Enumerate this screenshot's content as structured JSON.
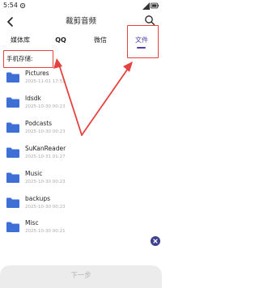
{
  "status_bar": {
    "time": "5:54",
    "icons": [
      "settings-icon",
      "signal-icon",
      "battery-icon"
    ]
  },
  "header": {
    "title": "裁剪音频",
    "back_icon": "back-arrow-icon",
    "search_icon": "search-icon"
  },
  "tabs": [
    {
      "label": "媒体库",
      "active": false
    },
    {
      "label": "QQ",
      "active": false
    },
    {
      "label": "微信",
      "active": false
    },
    {
      "label": "文件",
      "active": true
    }
  ],
  "storage_label": "手机存储:",
  "files": [
    {
      "name": "Pictures",
      "date": "2025-11-01 17:53"
    },
    {
      "name": "ldsdk",
      "date": "2025-10-30 00:23"
    },
    {
      "name": "Podcasts",
      "date": "2025-10-30 00:23"
    },
    {
      "name": "SuKanReader",
      "date": "2025-10-31 01:27"
    },
    {
      "name": "Music",
      "date": "2025-10-30 00:23"
    },
    {
      "name": "backups",
      "date": "2025-10-30 00:23"
    },
    {
      "name": "Misc",
      "date": "2025-10-30 00:21"
    }
  ],
  "next_button": "下一步",
  "colors": {
    "accent": "#4b3fa8",
    "folder": "#3d6fd6",
    "annotation": "#e4423f",
    "fab": "#3b3f8e",
    "date_text": "#aaaaaa"
  }
}
